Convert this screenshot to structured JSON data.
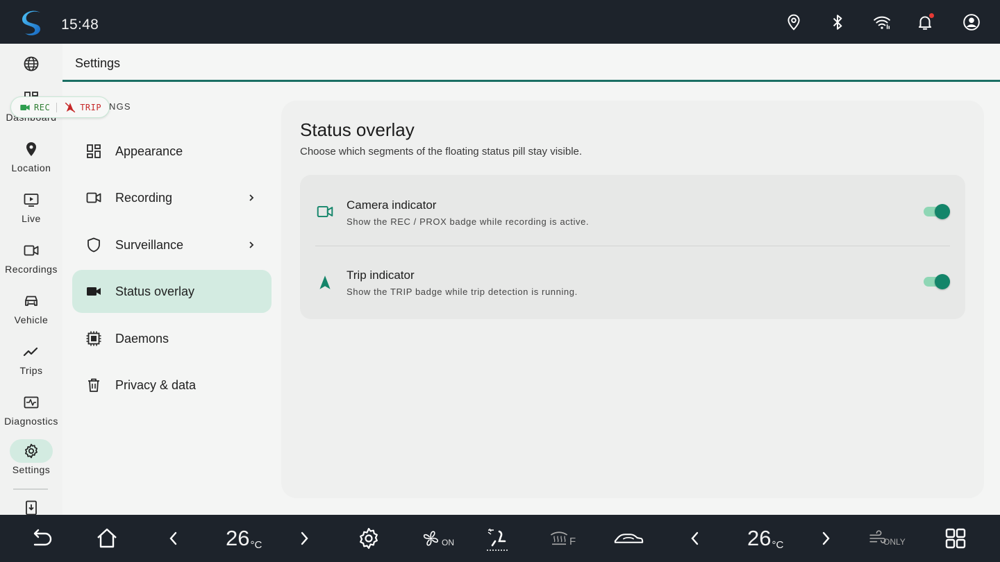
{
  "status_bar": {
    "time": "15:48",
    "icons": [
      "location-pin-icon",
      "bluetooth-icon",
      "wifi-icon",
      "bell-icon",
      "account-icon"
    ],
    "notification_dot_color": "#e53935"
  },
  "rail": {
    "items": [
      {
        "label": "",
        "icon": "globe-icon"
      },
      {
        "label": "Dashboard",
        "icon": "dashboard-icon"
      },
      {
        "label": "Location",
        "icon": "location-pin-icon"
      },
      {
        "label": "Live",
        "icon": "live-play-icon"
      },
      {
        "label": "Recordings",
        "icon": "video-camera-icon"
      },
      {
        "label": "Vehicle",
        "icon": "car-icon"
      },
      {
        "label": "Trips",
        "icon": "trend-line-icon"
      },
      {
        "label": "Diagnostics",
        "icon": "monitor-heart-icon"
      },
      {
        "label": "Settings",
        "icon": "gear-icon",
        "active": true
      },
      {
        "label": "",
        "icon": "install-icon"
      }
    ]
  },
  "status_pill": {
    "rec_label": "REC",
    "trip_label": "TRIP"
  },
  "header": {
    "title": "Settings"
  },
  "submenu": {
    "section_label_visible": "NGS",
    "items": [
      {
        "label": "Appearance",
        "icon": "grid-icon",
        "chevron": false
      },
      {
        "label": "Recording",
        "icon": "video-camera-icon",
        "chevron": true
      },
      {
        "label": "Surveillance",
        "icon": "shield-icon",
        "chevron": true
      },
      {
        "label": "Status overlay",
        "icon": "video-camera-filled-icon",
        "chevron": false,
        "active": true
      },
      {
        "label": "Daemons",
        "icon": "chip-icon",
        "chevron": false
      },
      {
        "label": "Privacy & data",
        "icon": "trash-icon",
        "chevron": false
      }
    ]
  },
  "main": {
    "title": "Status overlay",
    "subtitle": "Choose which segments of the floating status pill stay visible.",
    "options": [
      {
        "title": "Camera indicator",
        "description": "Show the REC / PROX badge while recording is active.",
        "enabled": true,
        "icon": "video-camera-icon"
      },
      {
        "title": "Trip indicator",
        "description": "Show the TRIP badge while trip detection is running.",
        "enabled": true,
        "icon": "navigation-arrow-icon"
      }
    ]
  },
  "dock": {
    "left_temp": "26",
    "right_temp": "26",
    "temp_unit": "°C",
    "fan_label": "ON",
    "defrost_label": "F",
    "airflow_label": "ONLY"
  },
  "colors": {
    "accent": "#1b6f64",
    "active_bg": "#d3ebe1",
    "toggle_on": "#14856a",
    "rec_green": "#2e7d32",
    "trip_red": "#c62828",
    "bar_bg": "#1d232b"
  }
}
